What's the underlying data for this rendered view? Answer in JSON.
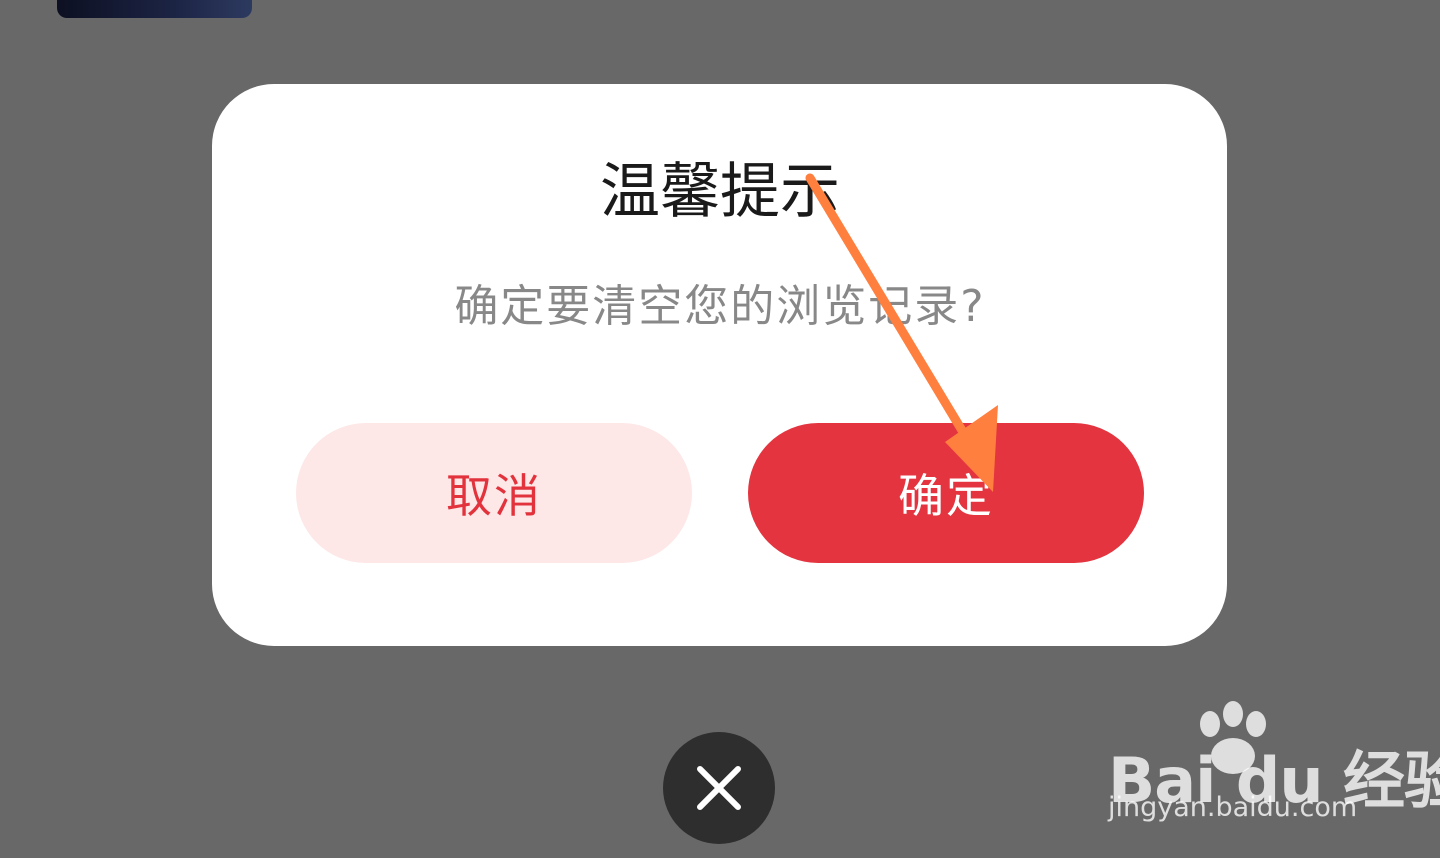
{
  "dialog": {
    "title": "温馨提示",
    "message": "确定要清空您的浏览记录?",
    "cancel_label": "取消",
    "confirm_label": "确定"
  },
  "close_icon": "close-icon",
  "watermark": {
    "logo_text": "Bai du 经验",
    "url": "jingyan.baidu.com"
  },
  "colors": {
    "overlay": "#686868",
    "primary_red": "#e3343f",
    "cancel_bg": "#fde7e7",
    "annotation_arrow": "#ff7f3f"
  }
}
